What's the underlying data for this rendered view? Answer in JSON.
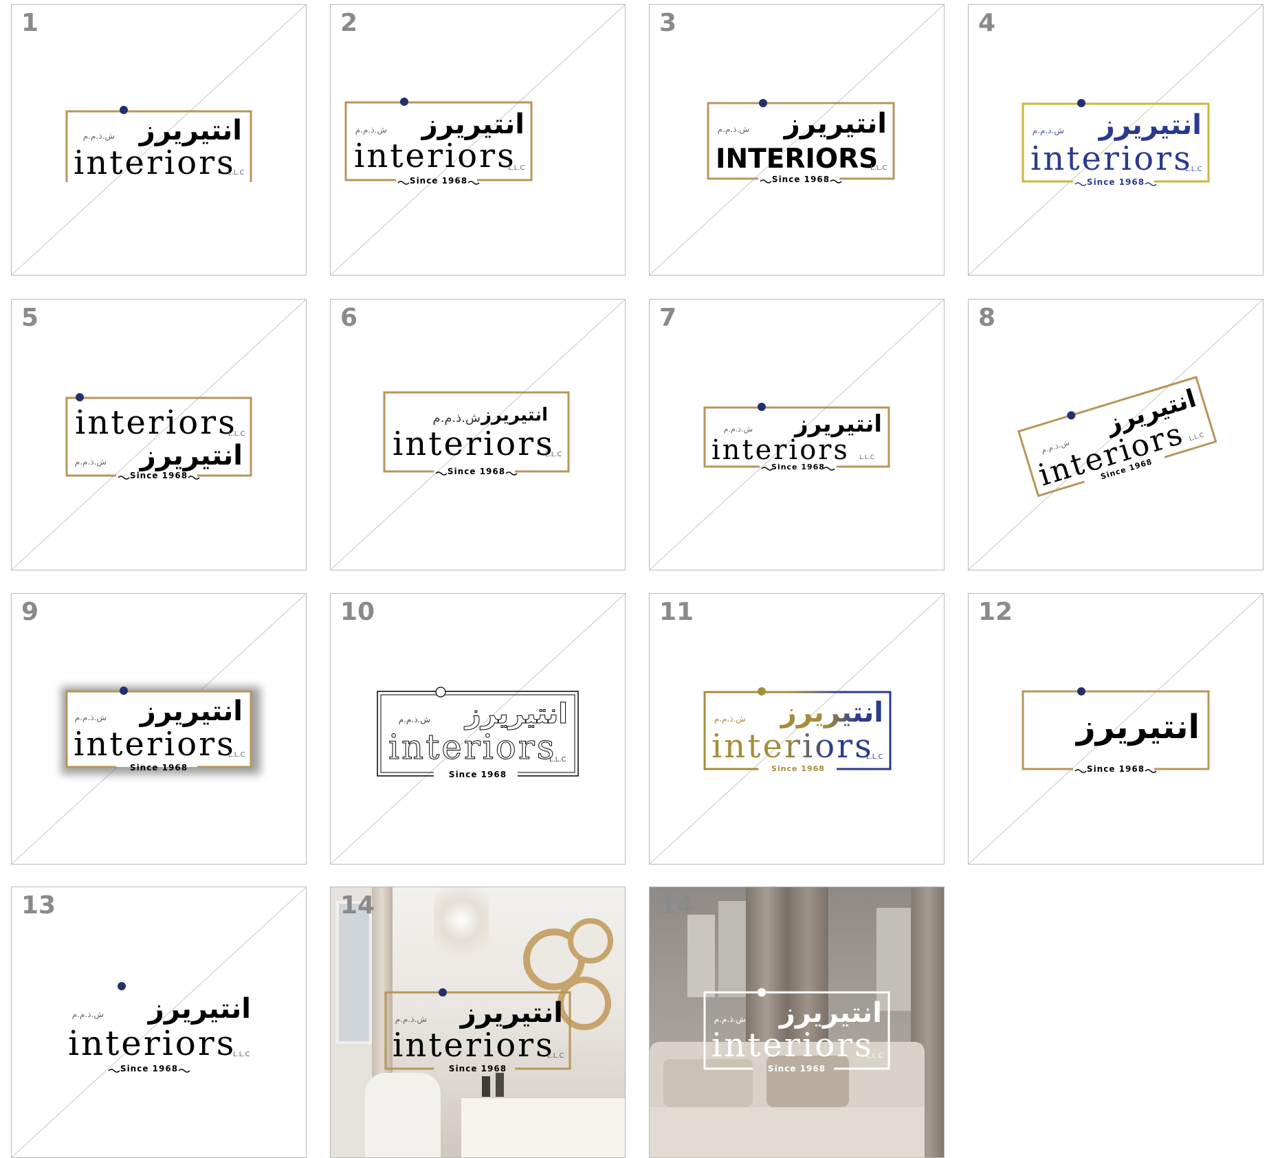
{
  "tiles": [
    {
      "number": "1"
    },
    {
      "number": "2"
    },
    {
      "number": "3"
    },
    {
      "number": "4"
    },
    {
      "number": "5"
    },
    {
      "number": "6"
    },
    {
      "number": "7"
    },
    {
      "number": "8"
    },
    {
      "number": "9"
    },
    {
      "number": "10"
    },
    {
      "number": "11"
    },
    {
      "number": "12"
    },
    {
      "number": "13"
    },
    {
      "number": "14"
    },
    {
      "number": "14"
    }
  ],
  "logo": {
    "arabic_name": "انتيريرز",
    "arabic_suffix": "ش.ذ.م.م",
    "latin_name": "interiors",
    "latin_name_caps": "INTERIORS",
    "legal_suffix": "L.L.C",
    "tagline": "Since 1968"
  },
  "colors": {
    "gold": "#b8955a",
    "navy": "#23306b",
    "royal_blue": "#2b3a8f",
    "olive_gold": "#c9b73a",
    "tile_border": "#b8b8b8",
    "number_gray": "#8a8a8a",
    "diagonal": "#cfcfcf"
  }
}
